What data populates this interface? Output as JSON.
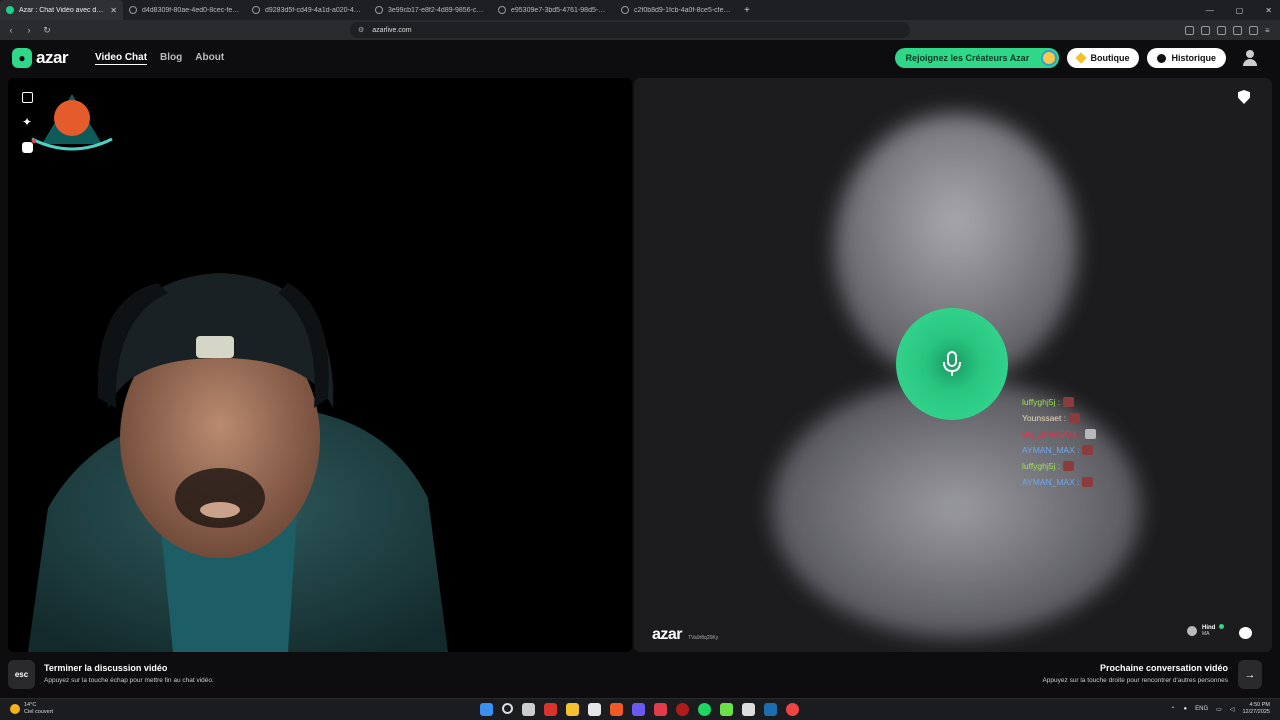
{
  "browser": {
    "tabs": [
      {
        "title": "Azar : Chat Vidéo avec de no",
        "active": true
      },
      {
        "title": "d4d8309f-80ae-4ed0-8cec-fe9942e0",
        "active": false
      },
      {
        "title": "d9283d5f-cd49-4a1d-a020-4db20fc",
        "active": false
      },
      {
        "title": "3e99cb17-e8f2-4d89-9856-cbb91df",
        "active": false
      },
      {
        "title": "e95309e7-3bd5-4761-98d5-1da6b8",
        "active": false
      },
      {
        "title": "c2f0b8d9-1fcb-4a0f-8ce5-cfef44d6",
        "active": false
      }
    ],
    "new_tab": "+",
    "url": "azarlive.com"
  },
  "app": {
    "logo_text": "azar",
    "nav": {
      "video_chat": "Video Chat",
      "blog": "Blog",
      "about": "About"
    },
    "creators_button": "Rejoignez les Créateurs Azar",
    "shop_button": "Boutique",
    "history_button": "Historique",
    "accent_color": "#2fd889"
  },
  "chat": [
    {
      "user": "luffyghj5j :",
      "color": "#9be35a"
    },
    {
      "user": "Younssaet :",
      "color": "#e8d9b6"
    },
    {
      "user": "BG_3IMADOX :",
      "color": "#e0354d"
    },
    {
      "user": "AYMAN_MAX :",
      "color": "#6fa8f0"
    },
    {
      "user": "luffyghj5j :",
      "color": "#9be35a"
    },
    {
      "user": "AYMAN_MAX :",
      "color": "#6fa8f0"
    }
  ],
  "remote": {
    "watermark": "azar",
    "watermark_id": "TVa9r8q20Ky",
    "peer_name": "Hind",
    "peer_country": "MA"
  },
  "footer": {
    "esc_key": "esc",
    "end_title": "Terminer la discussion vidéo",
    "end_hint": "Appuyez sur la touche échap pour mettre fin au chat vidéo.",
    "next_title": "Prochaine conversation vidéo",
    "next_hint": "Appuyez sur la touche droite pour rencontrer d'autres personnes",
    "next_arrow": "→"
  },
  "taskbar": {
    "temperature": "14°C",
    "weather": "Ciel couvert",
    "language": "ENG",
    "time": "4:50 PM",
    "date": "12/27/2025"
  }
}
